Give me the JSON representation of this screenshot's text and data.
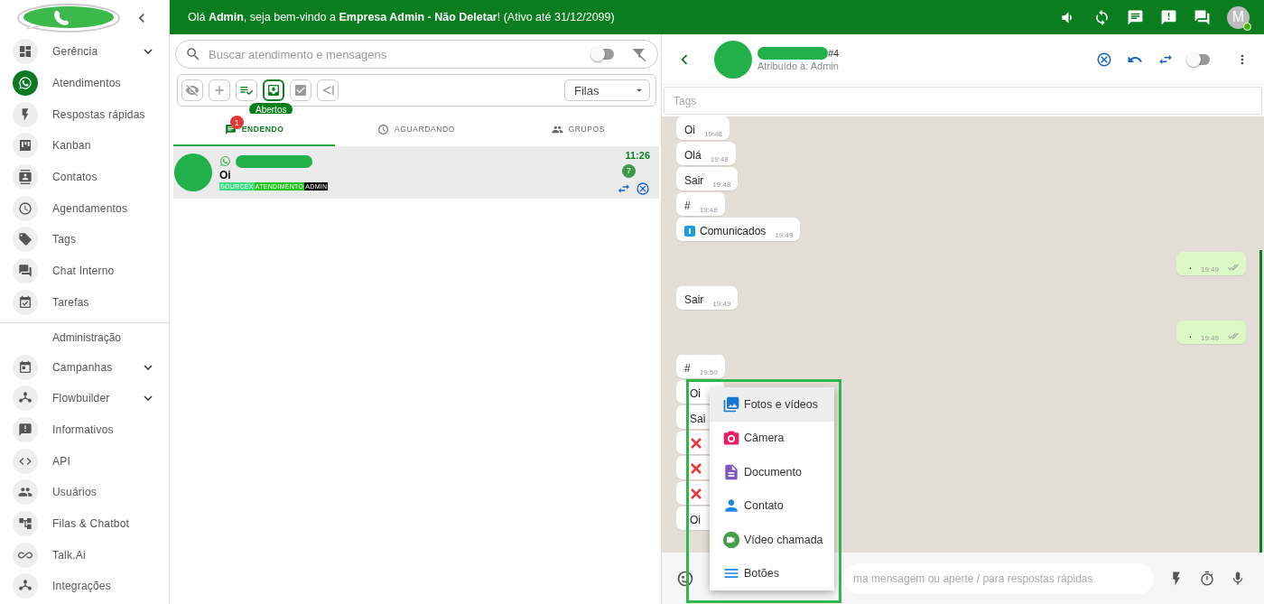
{
  "sidebar": {
    "items": [
      {
        "label": "Gerência",
        "selected": false,
        "has_submenu": true
      },
      {
        "label": "Atendimentos",
        "selected": true,
        "has_submenu": false
      },
      {
        "label": "Respostas rápidas",
        "selected": false,
        "has_submenu": false
      },
      {
        "label": "Kanban",
        "selected": false,
        "has_submenu": false
      },
      {
        "label": "Contatos",
        "selected": false,
        "has_submenu": false
      },
      {
        "label": "Agendamentos",
        "selected": false,
        "has_submenu": false
      },
      {
        "label": "Tags",
        "selected": false,
        "has_submenu": false
      },
      {
        "label": "Chat Interno",
        "selected": false,
        "has_submenu": false
      },
      {
        "label": "Tarefas",
        "selected": false,
        "has_submenu": false
      }
    ],
    "section_title": "Administração",
    "admin_items": [
      {
        "label": "Campanhas",
        "selected": false,
        "has_submenu": true
      },
      {
        "label": "Flowbuilder",
        "selected": false,
        "has_submenu": true
      },
      {
        "label": "Informativos",
        "selected": false,
        "has_submenu": false
      },
      {
        "label": "API",
        "selected": false,
        "has_submenu": false
      },
      {
        "label": "Usuários",
        "selected": false,
        "has_submenu": false
      },
      {
        "label": "Filas & Chatbot",
        "selected": false,
        "has_submenu": false
      },
      {
        "label": "Talk.Ai",
        "selected": false,
        "has_submenu": false
      },
      {
        "label": "Integrações",
        "selected": false,
        "has_submenu": false
      }
    ]
  },
  "top_bar": {
    "greeting": "Olá **Admin**, seja bem-vindo a **Empresa Admin - Não Deletar**! (Ativo até 31/12/2099)",
    "avatar": {
      "initial": "M",
      "online": true
    }
  },
  "ticket_list": {
    "search": {
      "placeholder": "Buscar atendimento e mensagens",
      "toggle_on": false
    },
    "toolbar": {
      "buttons": [
        {
          "selected": false
        },
        {
          "selected": false
        },
        {
          "selected": false
        },
        {
          "selected": true
        },
        {
          "selected": false
        },
        {
          "selected": false
        }
      ],
      "tooltip": "Abertos",
      "queue_select": {
        "value": "Filas"
      }
    },
    "tabs": [
      {
        "label": "ENDENDO",
        "badge": "1",
        "selected": true
      },
      {
        "label": "AGUARDANDO",
        "selected": false
      },
      {
        "label": "GRUPOS",
        "selected": false
      }
    ],
    "tickets": [
      {
        "last_message": "Oi",
        "time": "11:26",
        "unread": "7",
        "selected": true,
        "tags": [
          {
            "label": "SOURCEX",
            "color": "#3ddc84"
          },
          {
            "label": "ATENDIMENTO",
            "color": "#22c51f"
          },
          {
            "label": "ADMIN",
            "color": "#000000"
          }
        ]
      }
    ]
  },
  "chat": {
    "header": {
      "ticket_number": "#4",
      "assigned": "Atribuído à: Admin",
      "toggle_on": false
    },
    "tags_field": {
      "placeholder": "Tags"
    },
    "messages": [
      {
        "from_me": false,
        "kind": "text",
        "text": "Oi",
        "time": "19:48"
      },
      {
        "from_me": false,
        "kind": "text",
        "text": "Olá",
        "time": "19:48"
      },
      {
        "from_me": false,
        "kind": "text",
        "text": "Sair",
        "time": "19:48"
      },
      {
        "from_me": false,
        "kind": "text",
        "text": "#",
        "time": "19:48"
      },
      {
        "from_me": false,
        "kind": "broadcast",
        "text": "Comunicados",
        "time": "19:49"
      },
      {
        "from_me": true,
        "kind": "text",
        "text": ".",
        "time": "19:49"
      },
      {
        "from_me": false,
        "kind": "text",
        "text": "Sair",
        "time": "19:49"
      },
      {
        "from_me": true,
        "kind": "text",
        "text": ".",
        "time": "19:49"
      },
      {
        "from_me": false,
        "kind": "text",
        "text": "#",
        "time": "19:50"
      },
      {
        "from_me": false,
        "kind": "text",
        "text": "Oi"
      },
      {
        "from_me": false,
        "kind": "text",
        "text": "Sai"
      },
      {
        "from_me": false,
        "kind": "deleted"
      },
      {
        "from_me": false,
        "kind": "deleted"
      },
      {
        "from_me": false,
        "kind": "deleted"
      },
      {
        "from_me": false,
        "kind": "text",
        "text": "Oi"
      }
    ],
    "attach_menu": {
      "items": [
        {
          "label": "Fotos e vídeos",
          "selected": true
        },
        {
          "label": "Câmera",
          "selected": false
        },
        {
          "label": "Documento",
          "selected": false
        },
        {
          "label": "Contato",
          "selected": false
        },
        {
          "label": "Vídeo chamada",
          "selected": false
        },
        {
          "label": "Botões",
          "selected": false
        }
      ]
    },
    "composer": {
      "placeholder": "ma mensagem ou aperte / para respostas rápidas"
    }
  }
}
